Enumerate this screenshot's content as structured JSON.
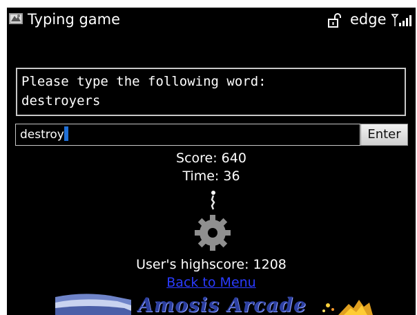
{
  "status_bar": {
    "app_title": "Typing game",
    "network": "edge",
    "app_icon": "gamepad-icon",
    "lock_icon": "unlocked-padlock-icon",
    "signal_icon": "signal-strength-icon"
  },
  "prompt": {
    "instruction": "Please type the following word:",
    "word": "destroyers"
  },
  "input": {
    "value": "destroy"
  },
  "enter_button": {
    "label": "Enter"
  },
  "stats": {
    "score": "Score: 640",
    "time": "Time: 36",
    "highscore": "User's highscore: 1208"
  },
  "progress_icon": "gear-progress-icon",
  "links": {
    "back_to_menu": "Back to Menu"
  },
  "banner": {
    "text": "Amosis Arcade"
  },
  "colors": {
    "background": "#000000",
    "text": "#ffffff",
    "link": "#2a3bff",
    "caret": "#1f6fd6"
  }
}
